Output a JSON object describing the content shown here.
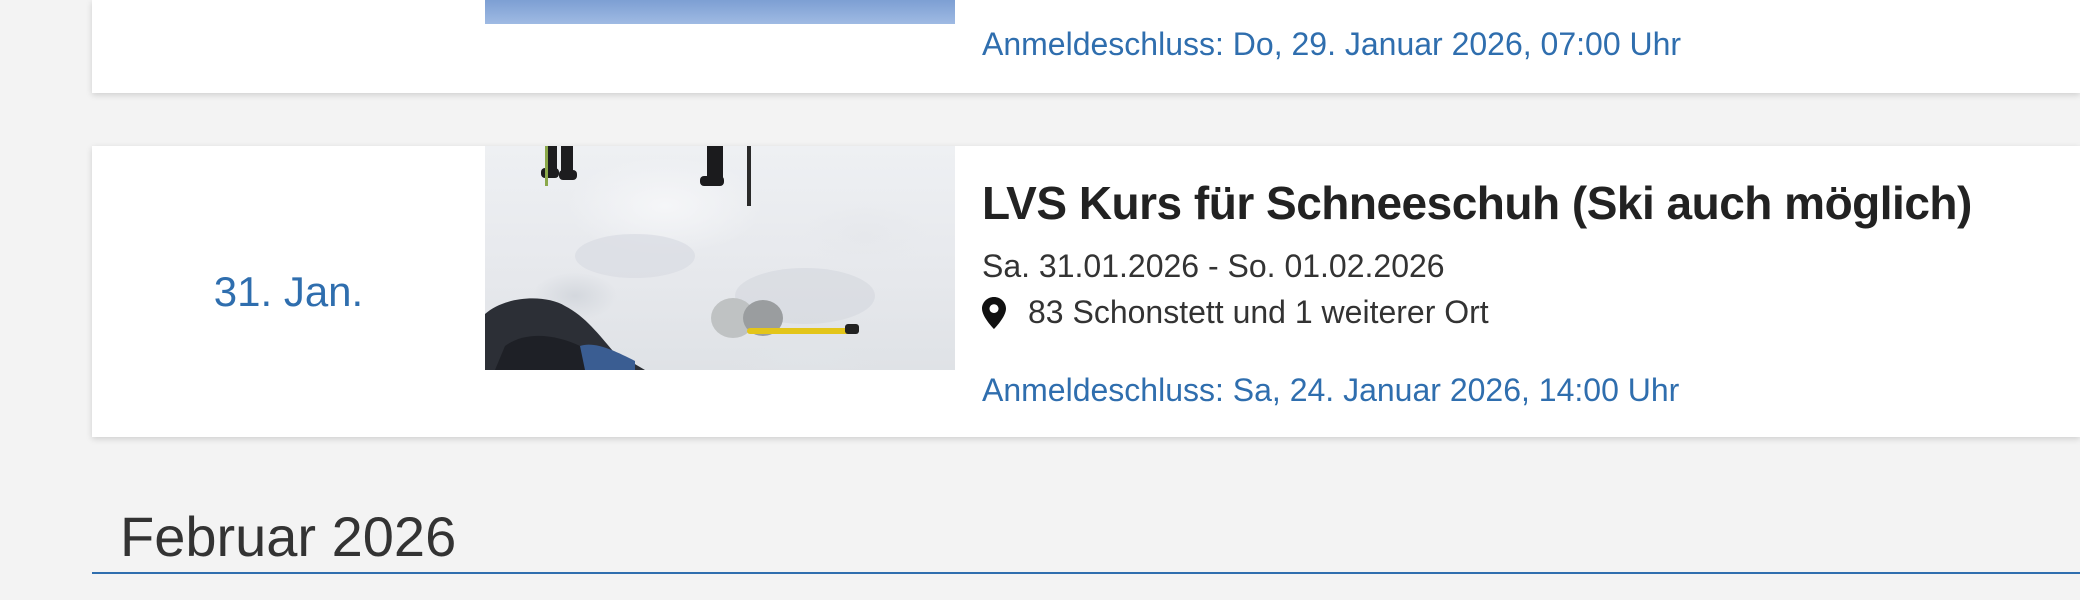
{
  "events": [
    {
      "deadline": "Anmeldeschluss: Do, 29. Januar 2026, 07:00 Uhr"
    },
    {
      "date_label": "31. Jan.",
      "title": "LVS Kurs für Schneeschuh (Ski auch möglich)",
      "dates": "Sa. 31.01.2026 - So. 01.02.2026",
      "location_icon": "map-pin-icon",
      "location": "83 Schonstett und 1 weiterer Ort",
      "deadline": "Anmeldeschluss: Sa, 24. Januar 2026, 14:00 Uhr"
    }
  ],
  "month_heading": "Februar 2026",
  "colors": {
    "accent": "#2f6eae",
    "background": "#f3f3f3",
    "card": "#ffffff",
    "text": "#222222"
  }
}
